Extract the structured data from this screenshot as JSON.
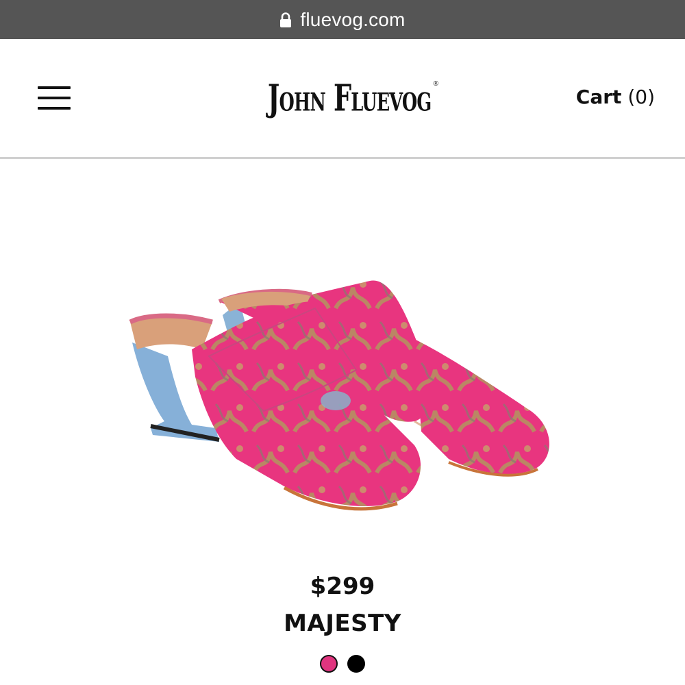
{
  "browser": {
    "url": "fluevog.com",
    "lock_icon": "lock-icon"
  },
  "header": {
    "menu_icon": "hamburger-menu-icon",
    "logo_text": "John Fluevog",
    "logo_registered_mark": "®",
    "cart_label": "Cart",
    "cart_count": "(0)"
  },
  "product": {
    "image_alt": "pink brocade velvet mule with sculpted blue heel",
    "price": "$299",
    "name": "MAJESTY",
    "swatches": [
      {
        "color": "#e0357f",
        "selected": true
      },
      {
        "color": "#000000",
        "selected": false
      }
    ]
  },
  "colors": {
    "url_bar_bg": "#555555",
    "divider": "#cfcfcf",
    "pink": "#e0357f",
    "text": "#111111"
  }
}
